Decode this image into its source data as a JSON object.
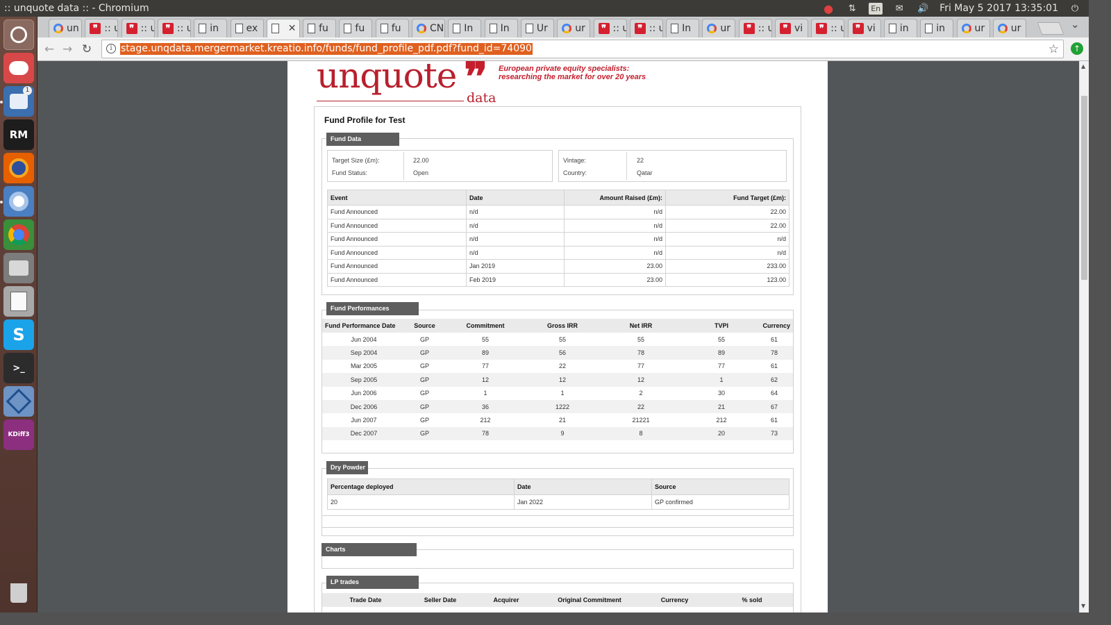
{
  "os_panel": {
    "window_title": ":: unquote data :: - Chromium",
    "lang": "En",
    "clock": "Fri May 5 2017 13:35:01"
  },
  "launcher": {
    "items": [
      "ubuntu-dash",
      "pidgin",
      "thunderbird",
      "rubymine",
      "firefox",
      "chromium",
      "chrome",
      "files",
      "text-editor",
      "skype",
      "terminal",
      "virtualbox",
      "kdiff3",
      "trash"
    ],
    "badge_count": "1",
    "rubymine_label": "RM",
    "kdiff3_label": "KDiff3"
  },
  "browser": {
    "tabs": [
      {
        "label": "un",
        "icon": "chrome"
      },
      {
        "label": ":: u",
        "icon": "quote"
      },
      {
        "label": ":: u",
        "icon": "quote"
      },
      {
        "label": ":: u",
        "icon": "quote"
      },
      {
        "label": "in",
        "icon": "doc"
      },
      {
        "label": "ex",
        "icon": "doc"
      },
      {
        "label": "",
        "icon": "doc"
      },
      {
        "label": "fu",
        "icon": "doc"
      },
      {
        "label": "fu",
        "icon": "doc"
      },
      {
        "label": "fu",
        "icon": "doc"
      },
      {
        "label": "CN",
        "icon": "chrome"
      },
      {
        "label": "In",
        "icon": "doc"
      },
      {
        "label": "In",
        "icon": "doc"
      },
      {
        "label": "Ur",
        "icon": "doc"
      },
      {
        "label": "ur",
        "icon": "chrome"
      },
      {
        "label": ":: u",
        "icon": "quote"
      },
      {
        "label": ":: u",
        "icon": "quote"
      },
      {
        "label": "In",
        "icon": "doc"
      },
      {
        "label": "ur",
        "icon": "chrome"
      },
      {
        "label": ":: u",
        "icon": "quote"
      },
      {
        "label": "vi",
        "icon": "quote"
      },
      {
        "label": ":: u",
        "icon": "quote"
      },
      {
        "label": "vi",
        "icon": "quote"
      },
      {
        "label": "in",
        "icon": "doc"
      },
      {
        "label": "in",
        "icon": "doc"
      },
      {
        "label": "ur",
        "icon": "chrome"
      },
      {
        "label": "ur",
        "icon": "chrome"
      }
    ],
    "active_tab_index": 6,
    "url": "stage.unqdata.mergermarket.kreatio.info/funds/fund_profile_pdf.pdf?fund_id=74090"
  },
  "brand": {
    "logo_word": "unquote",
    "logo_quote": "❞",
    "logo_data": "data",
    "tagline_1": "European private equity specialists:",
    "tagline_2": "researching the market for over 20 years",
    "color": "#c41e2c"
  },
  "report": {
    "title": "Fund Profile for Test",
    "fund_data": {
      "heading": "Fund Data",
      "target_size_label": "Target Size (£m):",
      "target_size_value": "22.00",
      "status_label": "Fund Status:",
      "status_value": "Open",
      "vintage_label": "Vintage:",
      "vintage_value": "22",
      "country_label": "Country:",
      "country_value": "Qatar",
      "events_headers": [
        "Event",
        "Date",
        "Amount Raised (£m):",
        "Fund Target (£m):"
      ],
      "events": [
        [
          "Fund Announced",
          "n/d",
          "n/d",
          "22.00"
        ],
        [
          "Fund Announced",
          "n/d",
          "n/d",
          "22.00"
        ],
        [
          "Fund Announced",
          "n/d",
          "n/d",
          "n/d"
        ],
        [
          "Fund Announced",
          "n/d",
          "n/d",
          "n/d"
        ],
        [
          "Fund Announced",
          "Jan 2019",
          "23.00",
          "233.00"
        ],
        [
          "Fund Announced",
          "Feb 2019",
          "23.00",
          "123.00"
        ]
      ]
    },
    "performances": {
      "heading": "Fund Performances",
      "headers": [
        "Fund Performance Date",
        "Source",
        "Commitment",
        "Gross IRR",
        "Net IRR",
        "TVPI",
        "Currency"
      ],
      "rows": [
        [
          "Jun 2004",
          "GP",
          "55",
          "55",
          "55",
          "55",
          "61"
        ],
        [
          "Sep 2004",
          "GP",
          "89",
          "56",
          "78",
          "89",
          "78"
        ],
        [
          "Mar 2005",
          "GP",
          "77",
          "22",
          "77",
          "77",
          "61"
        ],
        [
          "Sep 2005",
          "GP",
          "12",
          "12",
          "12",
          "1",
          "62"
        ],
        [
          "Jun 2006",
          "GP",
          "1",
          "1",
          "2",
          "30",
          "64"
        ],
        [
          "Dec 2006",
          "GP",
          "36",
          "1222",
          "22",
          "21",
          "67"
        ],
        [
          "Jun 2007",
          "GP",
          "212",
          "21",
          "21221",
          "212",
          "61"
        ],
        [
          "Dec 2007",
          "GP",
          "78",
          "9",
          "8",
          "20",
          "73"
        ]
      ]
    },
    "dry_powder": {
      "heading": "Dry Powder",
      "headers": [
        "Percentage deployed",
        "Date",
        "Source"
      ],
      "rows": [
        [
          "20",
          "Jan 2022",
          "GP confirmed"
        ]
      ]
    },
    "charts": {
      "heading": "Charts"
    },
    "lp_trades": {
      "heading": "LP trades",
      "headers": [
        "Trade Date",
        "Seller Date",
        "Acquirer",
        "Original Commitment",
        "Currency",
        "% sold"
      ]
    }
  }
}
